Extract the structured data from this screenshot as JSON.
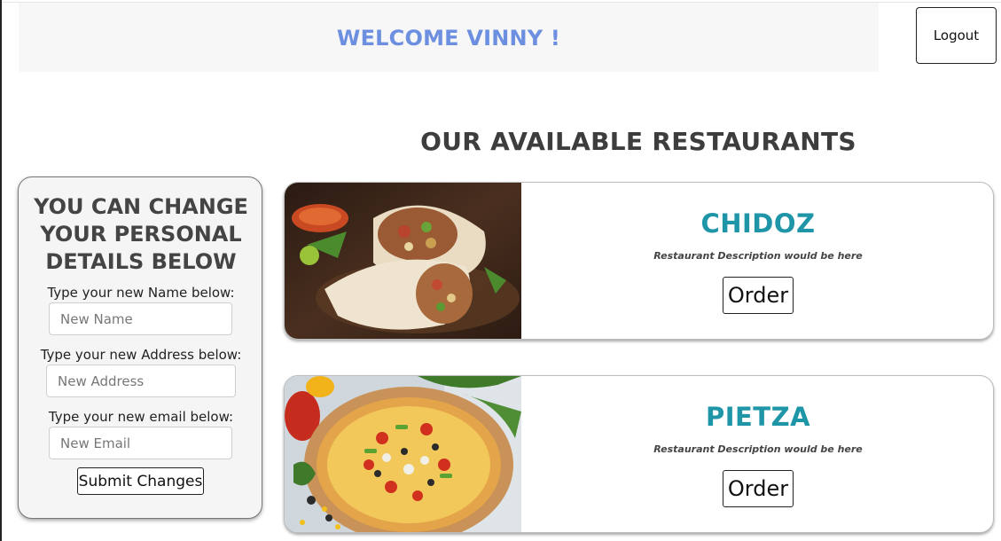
{
  "header": {
    "welcome": "WELCOME VINNY !",
    "logout_label": "Logout"
  },
  "restaurants_section": {
    "title": "OUR AVAILABLE RESTAURANTS"
  },
  "details_panel": {
    "title_line1": "YOU CAN CHANGE",
    "title_line2": "YOUR PERSONAL",
    "title_line3": "DETAILS BELOW",
    "name_label": "Type your new Name below:",
    "name_placeholder": "New Name",
    "address_label": "Type your new Address below:",
    "address_placeholder": "New Address",
    "email_label": "Type your new email below:",
    "email_placeholder": "New Email",
    "submit_label": "Submit Changes"
  },
  "restaurants": [
    {
      "name": "CHIDOZ",
      "description": "Restaurant Description would be here",
      "order_label": "Order",
      "image": "burrito-image"
    },
    {
      "name": "PIETZA",
      "description": "Restaurant Description would be here",
      "order_label": "Order",
      "image": "pizza-image"
    }
  ],
  "colors": {
    "welcome": "#6d8fe0",
    "restaurant_name": "#1f95a8",
    "panel_bg": "#f5f5f5"
  }
}
